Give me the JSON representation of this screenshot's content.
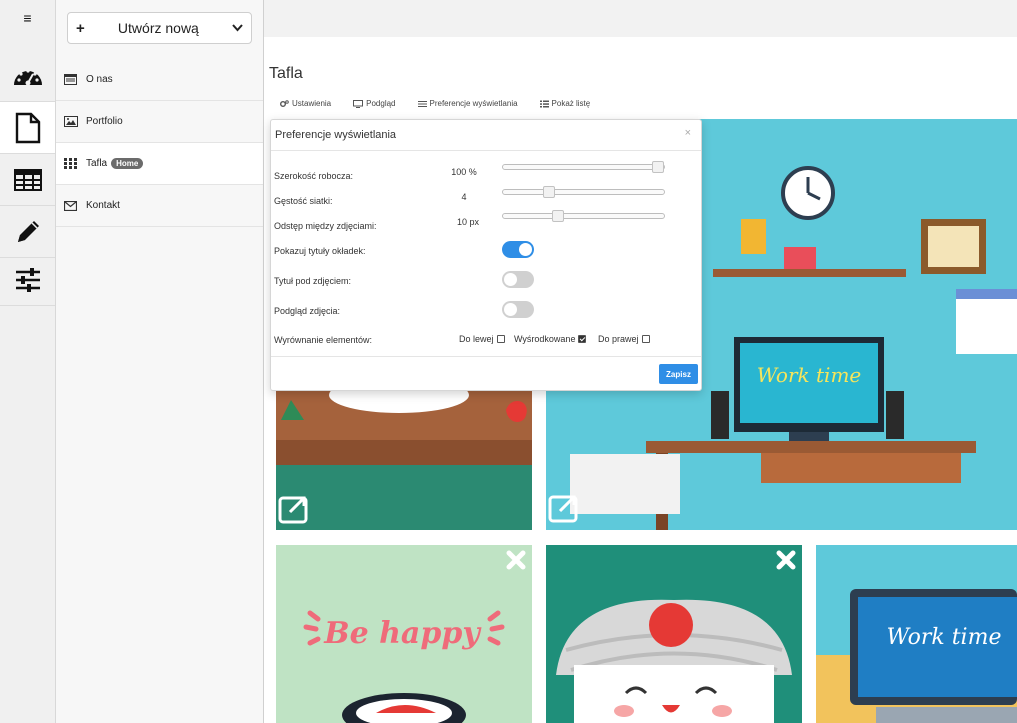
{
  "rail": {
    "menu_icon": "hamburger-icon",
    "items": [
      {
        "icon": "dashboard-icon"
      },
      {
        "icon": "page-icon"
      },
      {
        "icon": "table-icon"
      },
      {
        "icon": "pencil-icon"
      },
      {
        "icon": "sliders-icon"
      }
    ]
  },
  "sidebar": {
    "create_label": "Utwórz nową",
    "create_plus": "+",
    "pages": [
      {
        "label": "O nas",
        "icon": "window-icon"
      },
      {
        "label": "Portfolio",
        "icon": "image-icon"
      },
      {
        "label": "Tafla",
        "icon": "grid-icon",
        "badge": "Home"
      },
      {
        "label": "Kontakt",
        "icon": "envelope-icon"
      }
    ]
  },
  "main": {
    "title": "Tafla",
    "tabs": [
      {
        "label": "Ustawienia",
        "icon": "cogs-icon"
      },
      {
        "label": "Podgląd",
        "icon": "monitor-icon"
      },
      {
        "label": "Preferencje wyświetlania",
        "icon": "sliders-small-icon"
      },
      {
        "label": "Pokaż listę",
        "icon": "list-icon"
      }
    ],
    "tiles": [
      {
        "text": ""
      },
      {
        "text": "Work time"
      },
      {
        "text": "Be happy"
      },
      {
        "text": ""
      },
      {
        "text": "Work time"
      }
    ]
  },
  "modal": {
    "title": "Preferencje wyświetlania",
    "close": "×",
    "width_label": "Szerokość robocza:",
    "width_value": "100 %",
    "width_level": 1.0,
    "density_label": "Gęstość siatki:",
    "density_value": "4",
    "density_level": 0.27,
    "spacing_label": "Odstęp między zdjęciami:",
    "spacing_value": "10 px",
    "spacing_level": 0.33,
    "show_titles_label": "Pokazuj tytuły okładek:",
    "show_titles": true,
    "title_below_label": "Tytuł pod zdjęciem:",
    "title_below": false,
    "preview_label": "Podgląd zdjęcia:",
    "preview": false,
    "alignment_label": "Wyrównanie elementów:",
    "align_left": "Do lewej",
    "align_center": "Wyśrodkowane",
    "align_right": "Do prawej",
    "align_selected": "Wyśrodkowane",
    "save_label": "Zapisz"
  },
  "colors": {
    "accent": "#2f8ee6",
    "teal": "#1f8f7a",
    "sky": "#5ec9da",
    "mint": "#bfe3c4"
  }
}
